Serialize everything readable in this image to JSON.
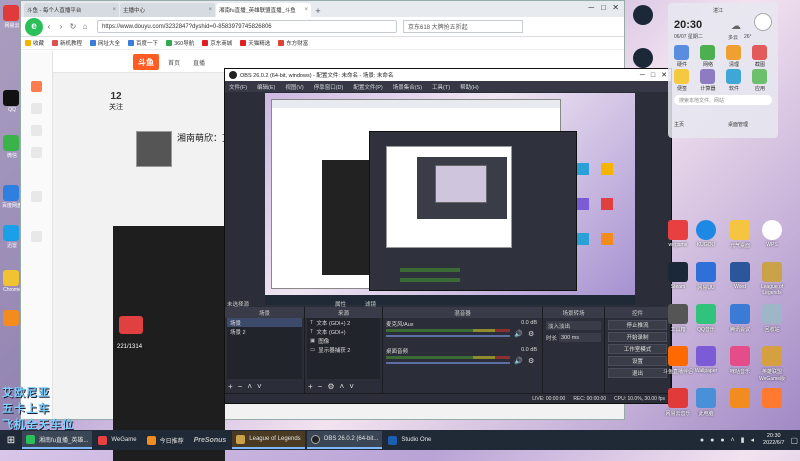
{
  "browser": {
    "tabs": [
      {
        "label": "斗鱼 - 每个人直播平台"
      },
      {
        "label": "主播中心"
      },
      {
        "label": "湘南fu直播_英雄联盟直播_斗鱼"
      }
    ],
    "url": "https://www.douyu.com/3232847?dyshid=0-8583979745826806",
    "search_text": "京东618 大牌抢五折起",
    "bookmarks": [
      "收藏",
      "新机教程",
      "网址大全",
      "百度一下",
      "360导航",
      "京东商城",
      "天猫精选",
      "东方财富"
    ],
    "site": {
      "logo": "斗鱼",
      "nav": [
        "首页",
        "直播"
      ],
      "follow_count": "12",
      "follow_label": "关注",
      "room_title": "湘南萌欣：艾欧尼亚",
      "level_badge": "221/1314"
    }
  },
  "obs": {
    "title": "OBS 26.0.2 (64-bit, windows) - 配置文件: 未命名 - 场景: 未命名",
    "menu": [
      "文件(F)",
      "编辑(E)",
      "视图(V)",
      "停靠窗口(D)",
      "配置文件(P)",
      "场景集合(S)",
      "工具(T)",
      "帮助(H)"
    ],
    "no_source": "未选择源",
    "scenes_title": "场景",
    "scenes": [
      "场景",
      "场景 2"
    ],
    "sources_title": "来源",
    "sources": [
      "文本 (GDI+) 2",
      "文本 (GDI+)",
      "图像",
      "显示器捕获 2"
    ],
    "mixer_title": "混音器",
    "mixer": [
      {
        "name": "麦克风/Aux",
        "db": "0.0 dB"
      },
      {
        "name": "桌面音频",
        "db": "0.0 dB"
      }
    ],
    "transitions_title": "场景转场",
    "transition_type": "淡入淡出",
    "duration_label": "时长",
    "duration": "300 ms",
    "controls_title": "控件",
    "controls": [
      "停止推流",
      "开始录制",
      "工作室模式",
      "设置",
      "退出"
    ],
    "status": [
      "LIVE: 00:00:00",
      "REC: 00:00:00",
      "CPU: 10.0%, 30.00 fps"
    ],
    "props_label": "属性",
    "filters_label": "滤镜"
  },
  "overlay_text": {
    "line1": "艾欧尼亚",
    "line2": "五卡上车",
    "line3": "飞机全天车位"
  },
  "widget": {
    "time": "20:30",
    "date": "06/07 星期二",
    "weather": "多云",
    "temp": "26°",
    "location": "湛江",
    "items": [
      "硬件",
      "网络",
      "清理",
      "截图",
      "便签",
      "计算器",
      "软件",
      "应用"
    ],
    "search_placeholder": "搜索本地文件、网站",
    "links": [
      "主页",
      "桌面管理"
    ]
  },
  "desktop_left_labels": [
    "网易云",
    "QQ",
    "微信",
    "百度网盘",
    "迅雷",
    "Chrome"
  ],
  "desktop_right": [
    {
      "label": "wegame"
    },
    {
      "label": "KUGOU"
    },
    {
      "label": "元气桌面"
    },
    {
      "label": "WPS"
    },
    {
      "label": "Steam"
    },
    {
      "label": "网易UU"
    },
    {
      "label": "Word"
    },
    {
      "label": "League of Legends"
    },
    {
      "label": "工具箱"
    },
    {
      "label": "QQ音乐"
    },
    {
      "label": "腾讯会议"
    },
    {
      "label": "回收站"
    },
    {
      "label": "斗鱼直播伴侣"
    },
    {
      "label": "Wallpaper"
    },
    {
      "label": "咪咕音乐"
    },
    {
      "label": "英雄联盟WeGame版"
    },
    {
      "label": "网易云音乐"
    },
    {
      "label": "此电脑"
    }
  ],
  "taskbar": {
    "items": [
      "湘南fu直播_英雄...",
      "WeGame",
      "今日推荐",
      "League of Legends",
      "OBS 26.0.2 (64-bit...",
      "Studio One"
    ],
    "center_logo": "PreSonus",
    "time": "20:30",
    "date": "2022/6/7"
  }
}
